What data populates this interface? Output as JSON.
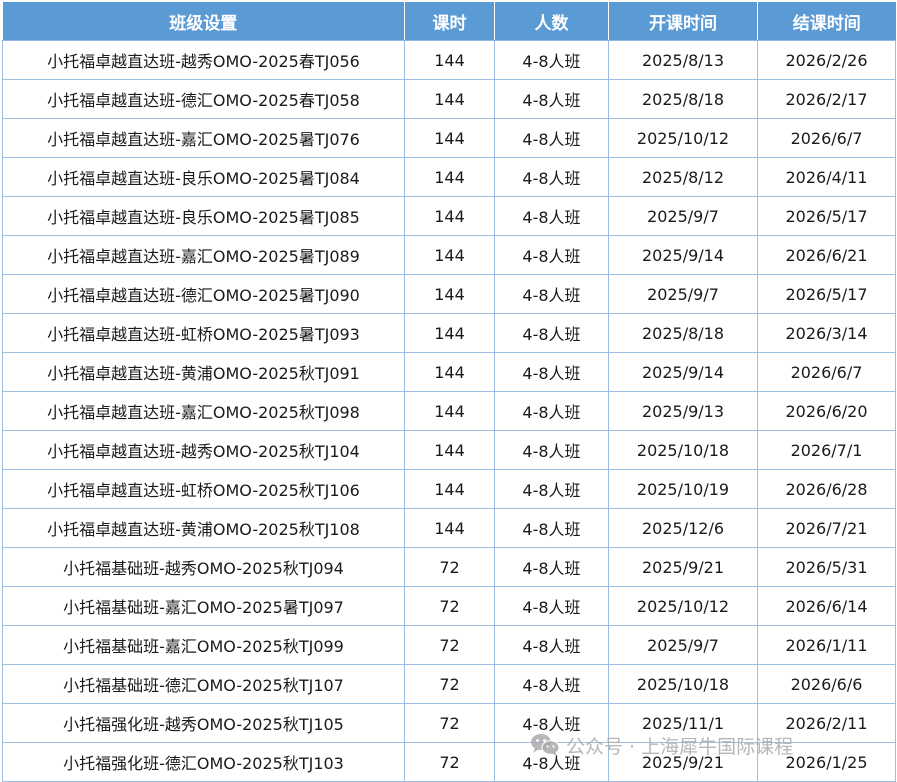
{
  "table": {
    "headers": [
      "班级设置",
      "课时",
      "人数",
      "开课时间",
      "结课时间"
    ],
    "rows": [
      [
        "小托福卓越直达班-越秀OMO-2025春TJ056",
        "144",
        "4-8人班",
        "2025/8/13",
        "2026/2/26"
      ],
      [
        "小托福卓越直达班-德汇OMO-2025春TJ058",
        "144",
        "4-8人班",
        "2025/8/18",
        "2026/2/17"
      ],
      [
        "小托福卓越直达班-嘉汇OMO-2025暑TJ076",
        "144",
        "4-8人班",
        "2025/10/12",
        "2026/6/7"
      ],
      [
        "小托福卓越直达班-良乐OMO-2025暑TJ084",
        "144",
        "4-8人班",
        "2025/8/12",
        "2026/4/11"
      ],
      [
        "小托福卓越直达班-良乐OMO-2025暑TJ085",
        "144",
        "4-8人班",
        "2025/9/7",
        "2026/5/17"
      ],
      [
        "小托福卓越直达班-嘉汇OMO-2025暑TJ089",
        "144",
        "4-8人班",
        "2025/9/14",
        "2026/6/21"
      ],
      [
        "小托福卓越直达班-德汇OMO-2025暑TJ090",
        "144",
        "4-8人班",
        "2025/9/7",
        "2026/5/17"
      ],
      [
        "小托福卓越直达班-虹桥OMO-2025暑TJ093",
        "144",
        "4-8人班",
        "2025/8/18",
        "2026/3/14"
      ],
      [
        "小托福卓越直达班-黄浦OMO-2025秋TJ091",
        "144",
        "4-8人班",
        "2025/9/14",
        "2026/6/7"
      ],
      [
        "小托福卓越直达班-嘉汇OMO-2025秋TJ098",
        "144",
        "4-8人班",
        "2025/9/13",
        "2026/6/20"
      ],
      [
        "小托福卓越直达班-越秀OMO-2025秋TJ104",
        "144",
        "4-8人班",
        "2025/10/18",
        "2026/7/1"
      ],
      [
        "小托福卓越直达班-虹桥OMO-2025秋TJ106",
        "144",
        "4-8人班",
        "2025/10/19",
        "2026/6/28"
      ],
      [
        "小托福卓越直达班-黄浦OMO-2025秋TJ108",
        "144",
        "4-8人班",
        "2025/12/6",
        "2026/7/21"
      ],
      [
        "小托福基础班-越秀OMO-2025秋TJ094",
        "72",
        "4-8人班",
        "2025/9/21",
        "2026/5/31"
      ],
      [
        "小托福基础班-嘉汇OMO-2025暑TJ097",
        "72",
        "4-8人班",
        "2025/10/12",
        "2026/6/14"
      ],
      [
        "小托福基础班-嘉汇OMO-2025秋TJ099",
        "72",
        "4-8人班",
        "2025/9/7",
        "2026/1/11"
      ],
      [
        "小托福基础班-德汇OMO-2025秋TJ107",
        "72",
        "4-8人班",
        "2025/10/18",
        "2026/6/6"
      ],
      [
        "小托福强化班-越秀OMO-2025秋TJ105",
        "72",
        "4-8人班",
        "2025/11/1",
        "2026/2/11"
      ],
      [
        "小托福强化班-德汇OMO-2025秋TJ103",
        "72",
        "4-8人班",
        "2025/9/21",
        "2026/1/25"
      ]
    ]
  },
  "watermark": {
    "text": "公众号 · 上海犀牛国际课程",
    "icon": "wechat-icon"
  },
  "colors": {
    "header_bg": "#5b9bd5",
    "header_text": "#ffffff",
    "border": "#9dbfe3",
    "cell_text": "#1a1a1a"
  }
}
